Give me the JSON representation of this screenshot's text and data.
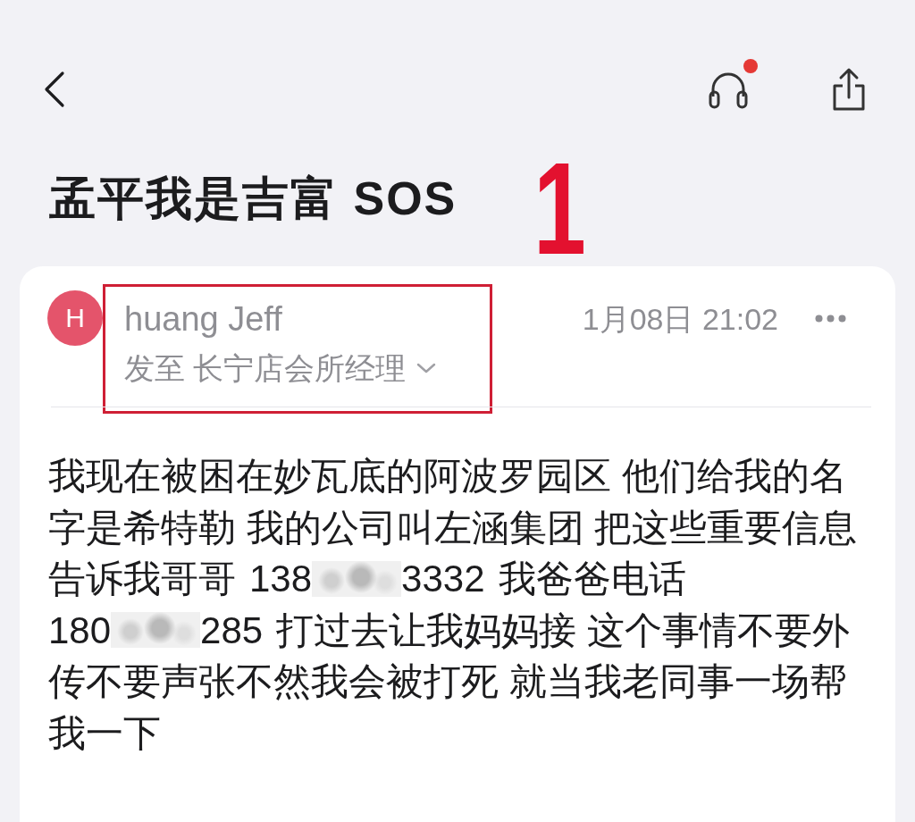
{
  "top_bar": {
    "listen_badge": true
  },
  "subject": "孟平我是吉富 SOS",
  "annotation": {
    "label": "1"
  },
  "message": {
    "sender": {
      "initial": "H",
      "name": "huang Jeff",
      "recipients": "发至 长宁店会所经理",
      "highlighted": true
    },
    "date": "1月08日 21:02",
    "body_lines": [
      {
        "parts": [
          {
            "kind": "text",
            "text": "我现在被困在妙瓦底的阿波罗园区 他们给我的名"
          }
        ]
      },
      {
        "parts": [
          {
            "kind": "text",
            "text": "字是希特勒 我的公司叫左涵集团 把这些重要信息"
          }
        ]
      },
      {
        "parts": [
          {
            "kind": "text",
            "text": "告诉我哥哥"
          },
          {
            "kind": "masked_number",
            "start": "138",
            "end": "3332"
          },
          {
            "kind": "text",
            "text": "我爸爸电话"
          }
        ]
      },
      {
        "parts": [
          {
            "kind": "masked_number",
            "start": "180",
            "end": "285"
          },
          {
            "kind": "text",
            "text": "打过去让我妈妈接 这个事情不要外"
          }
        ]
      },
      {
        "parts": [
          {
            "kind": "text",
            "text": "传不要声张不然我会被打死 就当我老同事一场帮"
          }
        ]
      },
      {
        "parts": [
          {
            "kind": "text",
            "text": "我一下"
          }
        ]
      }
    ]
  }
}
